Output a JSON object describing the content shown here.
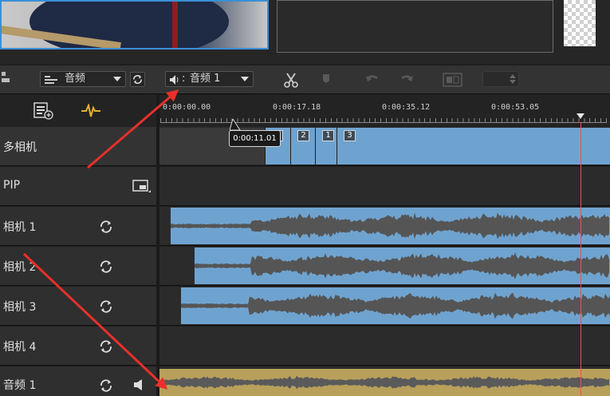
{
  "toolbar": {
    "source_dropdown": "音频",
    "track_dropdown": "音频 1"
  },
  "ruler": {
    "timecodes": [
      "0:00:00.00",
      "0:00:17.18",
      "0:00:35.12",
      "0:00:53.05"
    ],
    "tooltip": "0:00:11.01"
  },
  "multicam": {
    "badges": [
      "2",
      "1",
      "3"
    ]
  },
  "tracks": [
    {
      "name": "多相机"
    },
    {
      "name": "PIP"
    },
    {
      "name": "相机 1"
    },
    {
      "name": "相机 2"
    },
    {
      "name": "相机 3"
    },
    {
      "name": "相机 4"
    },
    {
      "name": "音频 1"
    }
  ],
  "colors": {
    "clip_blue": "#6fa3cf",
    "audio_gold": "#b8a05b",
    "playhead": "#e8505b",
    "annotation": "#e8302c",
    "selection": "#3b8fd6"
  }
}
